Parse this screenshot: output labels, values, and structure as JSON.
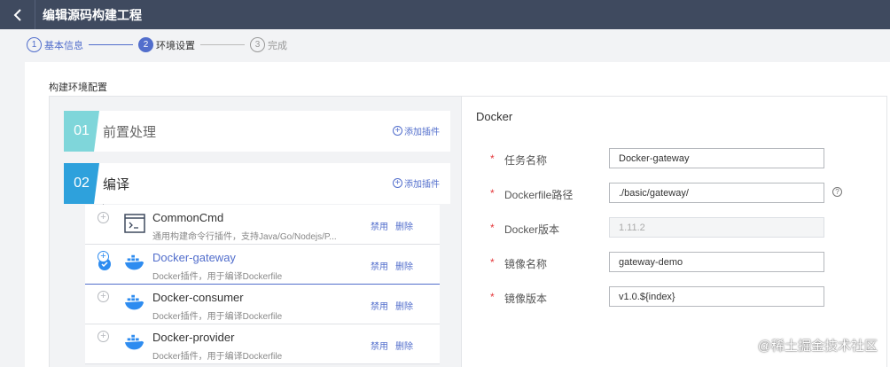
{
  "header": {
    "title": "编辑源码构建工程"
  },
  "steps": [
    {
      "num": "1",
      "label": "基本信息"
    },
    {
      "num": "2",
      "label": "环境设置"
    },
    {
      "num": "3",
      "label": "完成"
    }
  ],
  "section_label": "构建环境配置",
  "stages": [
    {
      "num": "01",
      "name": "前置处理",
      "add_label": "添加插件",
      "color": "#7fd6da"
    },
    {
      "num": "02",
      "name": "编译",
      "add_label": "添加插件",
      "color": "#2ea1dc"
    }
  ],
  "plugins": [
    {
      "name": "CommonCmd",
      "desc": "通用构建命令行插件，支持Java/Go/Nodejs/P...",
      "disable": "禁用",
      "delete": "删除",
      "icon": "terminal-icon"
    },
    {
      "name": "Docker-gateway",
      "desc": "Docker插件，用于编译Dockerfile",
      "disable": "禁用",
      "delete": "删除",
      "icon": "docker-icon"
    },
    {
      "name": "Docker-consumer",
      "desc": "Docker插件，用于编译Dockerfile",
      "disable": "禁用",
      "delete": "删除",
      "icon": "docker-icon"
    },
    {
      "name": "Docker-provider",
      "desc": "Docker插件，用于编译Dockerfile",
      "disable": "禁用",
      "delete": "删除",
      "icon": "docker-icon"
    }
  ],
  "detail": {
    "title": "Docker",
    "fields": [
      {
        "label": "任务名称",
        "value": "Docker-gateway",
        "required": "*"
      },
      {
        "label": "Dockerfile路径",
        "value": "./basic/gateway/",
        "required": "*",
        "help": "?"
      },
      {
        "label": "Docker版本",
        "value": "1.11.2",
        "required": "*"
      },
      {
        "label": "镜像名称",
        "value": "gateway-demo",
        "required": "*"
      },
      {
        "label": "镜像版本",
        "value": "v1.0.${index}",
        "required": "*"
      }
    ]
  },
  "watermark": "@稀土掘金技术社区",
  "colors": {
    "header_bg": "#3f4a5f",
    "accent": "#526ecc",
    "selected": "#2e8cf0",
    "required": "#e4393c"
  }
}
